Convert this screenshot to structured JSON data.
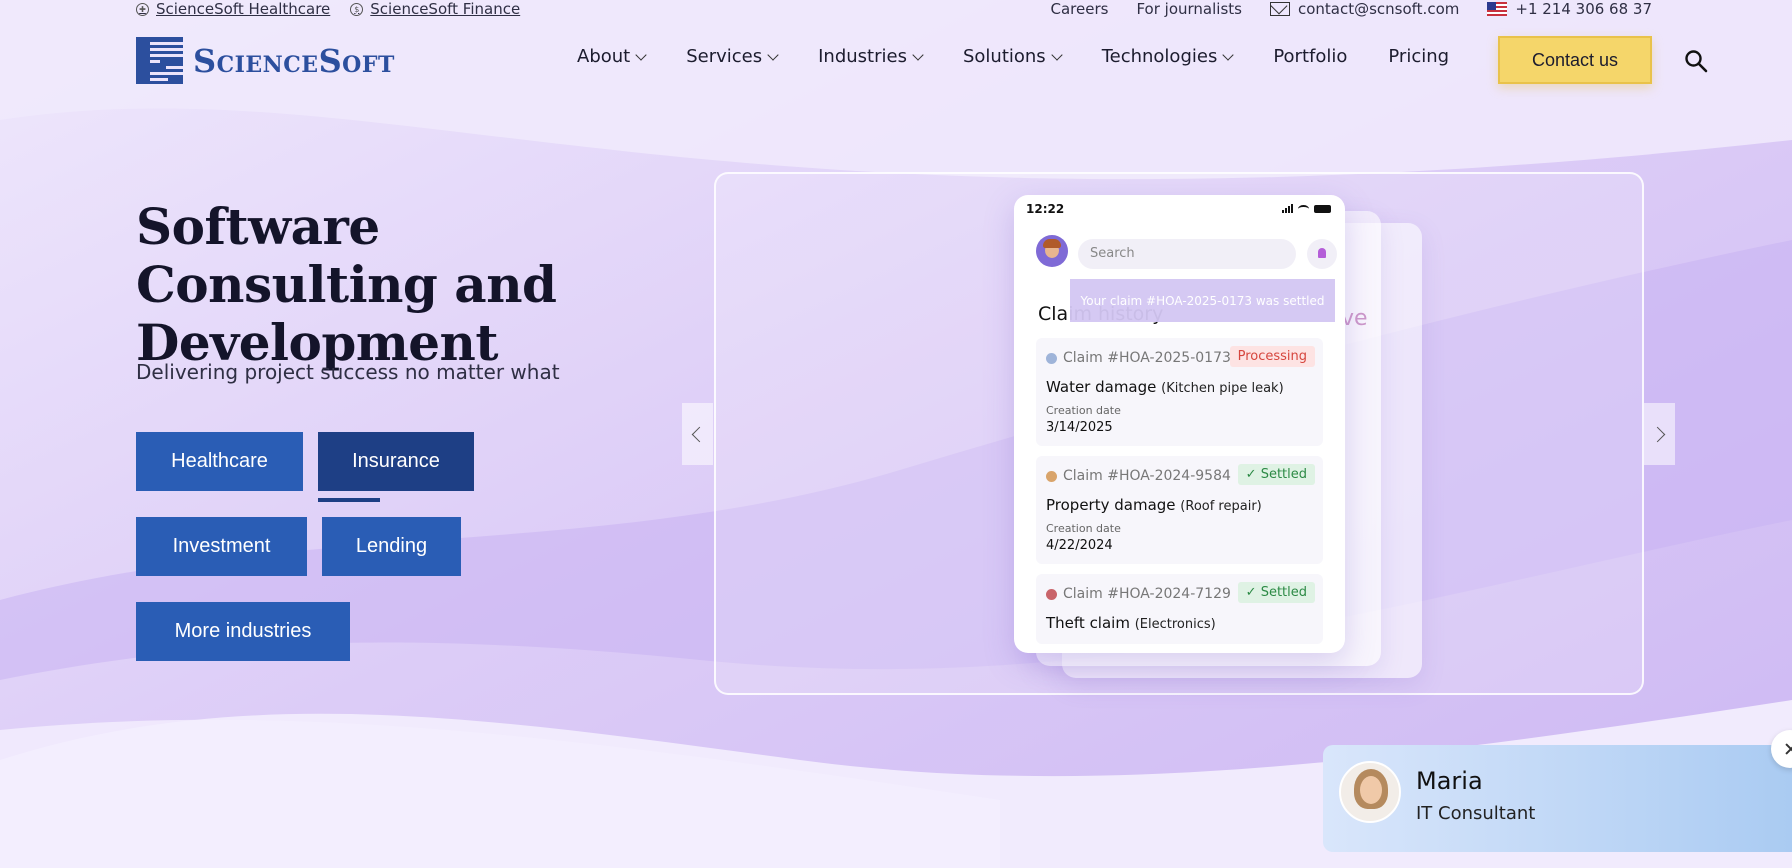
{
  "topbar": {
    "healthcare_link": "ScienceSoft Healthcare",
    "finance_link": "ScienceSoft Finance",
    "careers": "Careers",
    "journalists": "For journalists",
    "email": "contact@scnsoft.com",
    "phone": "+1 214 306 68 37"
  },
  "header": {
    "logo_text": "ScienceSoft",
    "nav": {
      "about": "About",
      "services": "Services",
      "industries": "Industries",
      "solutions": "Solutions",
      "technologies": "Technologies",
      "portfolio": "Portfolio",
      "pricing": "Pricing"
    },
    "contact_label": "Contact us"
  },
  "hero": {
    "title": "Software Consulting and Development",
    "subtitle": "Delivering project success no matter what",
    "buttons": {
      "healthcare": "Healthcare",
      "insurance": "Insurance",
      "investment": "Investment",
      "lending": "Lending",
      "more": "More industries"
    }
  },
  "phone": {
    "time": "12:22",
    "search_placeholder": "Search",
    "toast": "Your claim #HOA-2025-0173 was settled",
    "heading": "Claim history",
    "claims": [
      {
        "num": "Claim #HOA-2025-0173",
        "status": "Processing",
        "title": "Water damage",
        "detail": "(Kitchen pipe leak)",
        "date_label": "Creation date",
        "date": "3/14/2025"
      },
      {
        "num": "Claim #HOA-2024-9584",
        "status": "Settled",
        "title": "Property damage",
        "detail": "(Roof repair)",
        "date_label": "Creation date",
        "date": "4/22/2024"
      },
      {
        "num": "Claim #HOA-2024-7129",
        "status": "Settled",
        "title": "Theft claim",
        "detail": "(Electronics)"
      }
    ],
    "ghost_text": "ve"
  },
  "consultant": {
    "name": "Maria",
    "role": "IT Consultant"
  },
  "colors": {
    "primary_button": "#2a5db5",
    "active_button": "#1e3f85",
    "contact_button": "#f5d66a",
    "processing": "#d6453d",
    "settled": "#2c8a45"
  }
}
